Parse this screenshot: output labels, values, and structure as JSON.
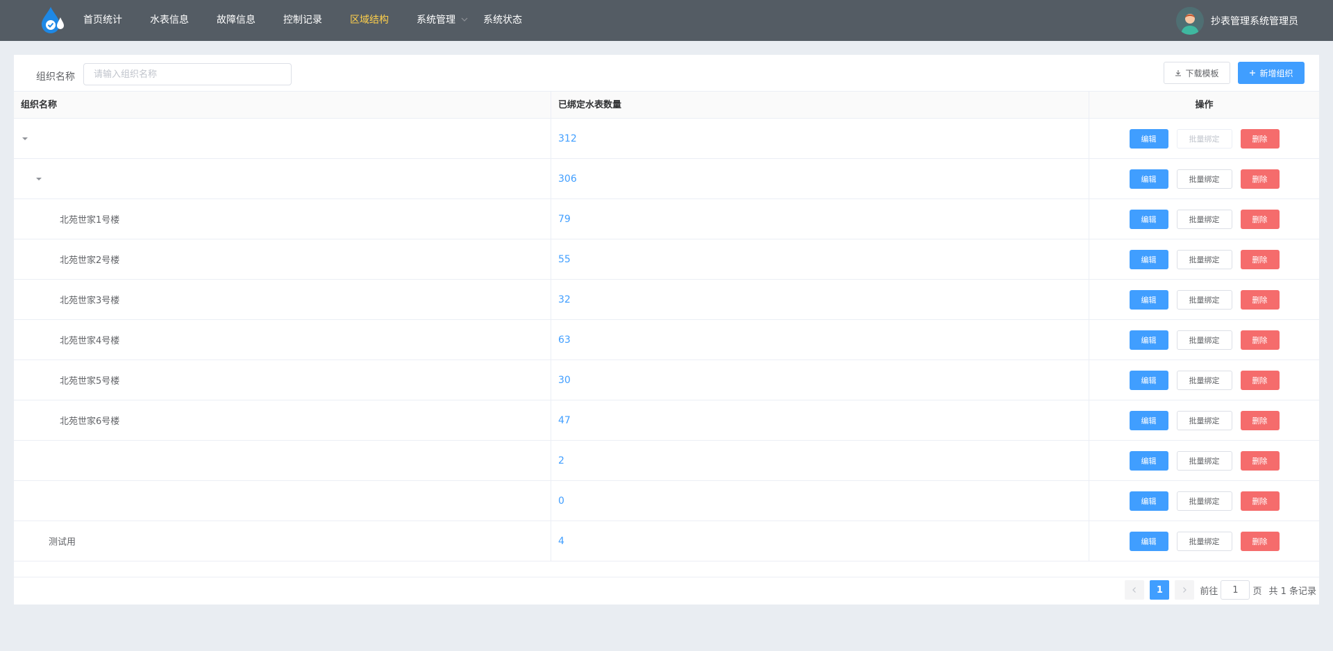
{
  "nav": {
    "items": [
      {
        "label": "首页统计",
        "active": false
      },
      {
        "label": "水表信息",
        "active": false
      },
      {
        "label": "故障信息",
        "active": false
      },
      {
        "label": "控制记录",
        "active": false
      },
      {
        "label": "区域结构",
        "active": true
      },
      {
        "label": "系统管理",
        "active": false
      },
      {
        "label": "系统状态",
        "active": false
      }
    ],
    "user_name": "抄表管理系统管理员"
  },
  "search": {
    "label": "组织名称",
    "placeholder": "请输入组织名称",
    "value": ""
  },
  "toolbar": {
    "download_label": "下载模板",
    "add_label": "新增组织"
  },
  "table": {
    "columns": [
      "组织名称",
      "已绑定水表数量",
      "操作"
    ],
    "actions": {
      "edit": "编辑",
      "bind": "批量绑定",
      "delete": "删除"
    },
    "rows": [
      {
        "name": "",
        "count": "312",
        "level": 0,
        "expandable": true,
        "bind_disabled": true
      },
      {
        "name": "",
        "count": "306",
        "level": 1,
        "expandable": true,
        "bind_disabled": false
      },
      {
        "name": "北苑世家1号楼",
        "count": "79",
        "level": 2,
        "expandable": false,
        "bind_disabled": false
      },
      {
        "name": "北苑世家2号楼",
        "count": "55",
        "level": 2,
        "expandable": false,
        "bind_disabled": false
      },
      {
        "name": "北苑世家3号楼",
        "count": "32",
        "level": 2,
        "expandable": false,
        "bind_disabled": false
      },
      {
        "name": "北苑世家4号楼",
        "count": "63",
        "level": 2,
        "expandable": false,
        "bind_disabled": false
      },
      {
        "name": "北苑世家5号楼",
        "count": "30",
        "level": 2,
        "expandable": false,
        "bind_disabled": false
      },
      {
        "name": "北苑世家6号楼",
        "count": "47",
        "level": 2,
        "expandable": false,
        "bind_disabled": false
      },
      {
        "name": "",
        "count": "2",
        "level": 1,
        "expandable": false,
        "bind_disabled": false
      },
      {
        "name": "",
        "count": "0",
        "level": 1,
        "expandable": false,
        "bind_disabled": false
      },
      {
        "name": "测试用",
        "count": "4",
        "level": 1,
        "expandable": false,
        "bind_disabled": false
      }
    ]
  },
  "pagination": {
    "current_page": "1",
    "goto_label": "前往",
    "goto_value": "1",
    "page_suffix": "页",
    "total_text": "共 1 条记录"
  },
  "colors": {
    "primary": "#409eff",
    "danger": "#f56c6c",
    "nav_bg": "#545c64",
    "nav_active": "#ffd04b"
  }
}
